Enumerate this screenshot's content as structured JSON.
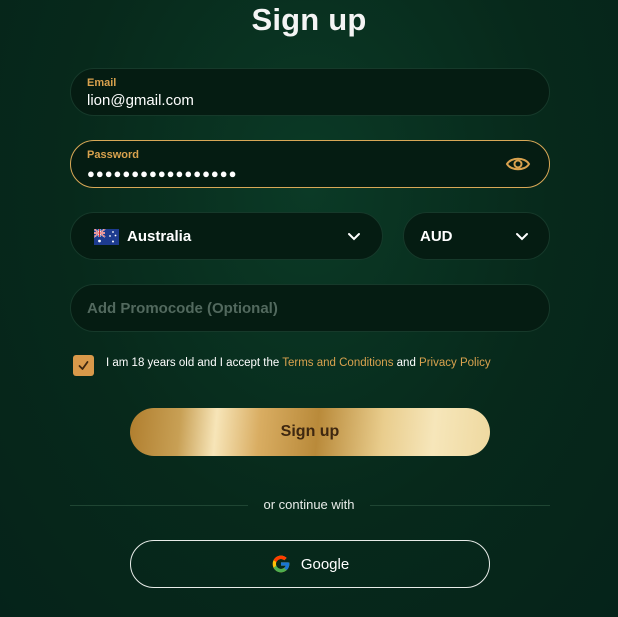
{
  "form": {
    "title": "Sign up",
    "email": {
      "label": "Email",
      "value": "lion@gmail.com"
    },
    "password": {
      "label": "Password",
      "value": "●●●●●●●●●●●●●●●●●",
      "toggle_icon": "eye-icon"
    },
    "country": {
      "value": "Australia",
      "flag_icon": "australia-flag-icon",
      "chevron_icon": "chevron-down-icon"
    },
    "currency": {
      "value": "AUD",
      "chevron_icon": "chevron-down-icon"
    },
    "promocode": {
      "placeholder": "Add Promocode (Optional)"
    },
    "consent": {
      "checked": true,
      "prefix": "I am 18 years old and I accept the ",
      "terms_link": "Terms and Conditions",
      "middle": " and ",
      "privacy_link": "Privacy Policy"
    },
    "submit_label": "Sign up",
    "divider_text": "or continue with",
    "google_label": "Google"
  },
  "colors": {
    "background": "#07291b",
    "accent": "#d9a24e",
    "field_bg": "#051c12"
  }
}
